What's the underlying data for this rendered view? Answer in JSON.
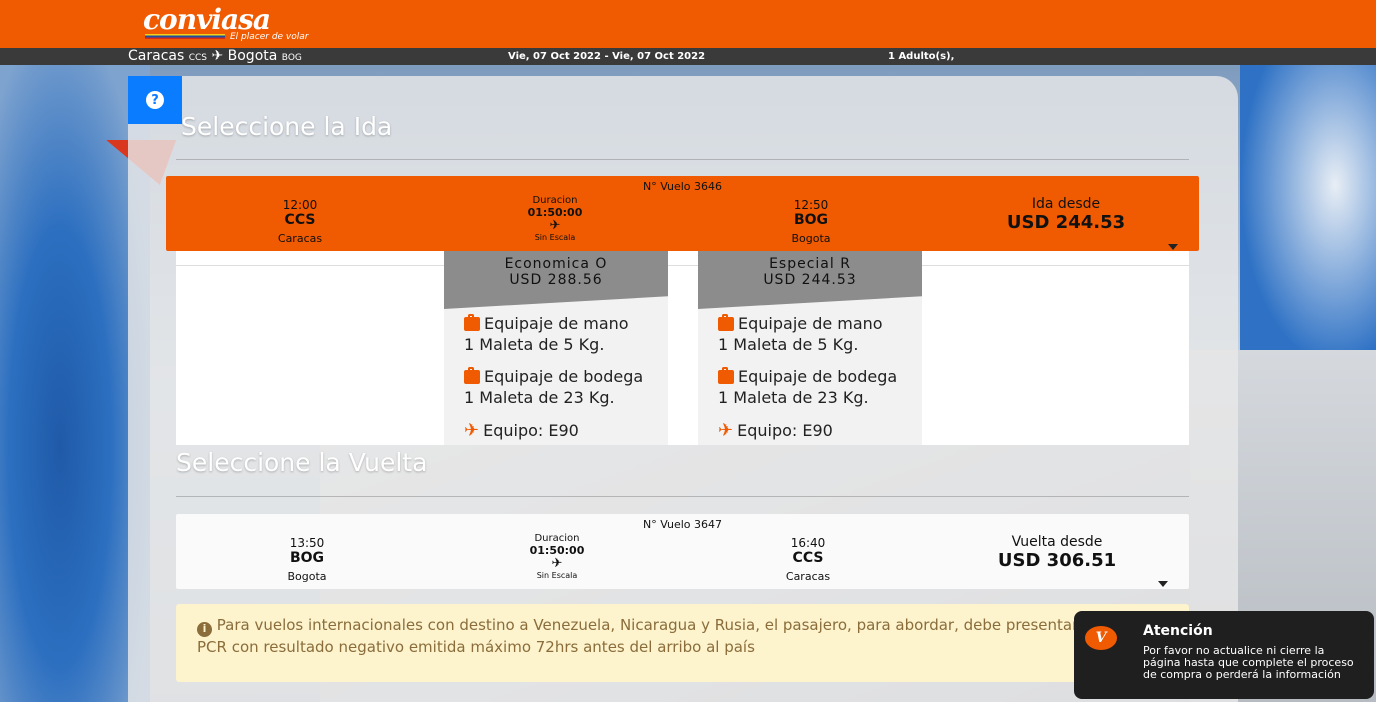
{
  "brand": {
    "logo_text": "conviasa",
    "tagline": "El placer de volar",
    "accent": "#f05a00"
  },
  "search": {
    "origin_city": "Caracas",
    "origin_code": "CCS",
    "destination_city": "Bogota",
    "destination_code": "BOG",
    "dates": "Vie, 07 Oct 2022 - Vie, 07 Oct 2022",
    "passengers": "1 Adulto(s),"
  },
  "outbound": {
    "title": "Seleccione la Ida",
    "flight_number": "N° Vuelo 3646",
    "depart_time": "12:00",
    "depart_code": "CCS",
    "depart_city": "Caracas",
    "duration_label": "Duracion",
    "duration": "01:50:00",
    "stops": "Sin Escala",
    "arrive_time": "12:50",
    "arrive_code": "BOG",
    "arrive_city": "Bogota",
    "price_label": "Ida desde",
    "price": "USD 244.53"
  },
  "fares": [
    {
      "name": "Economica O",
      "price": "USD 288.56",
      "carry_on_label": "Equipaje de mano",
      "carry_on_value": "1 Maleta de 5 Kg.",
      "checked_label": "Equipaje de bodega",
      "checked_value": "1 Maleta de 23 Kg.",
      "equipment": "Equipo: E90"
    },
    {
      "name": "Especial R",
      "price": "USD 244.53",
      "carry_on_label": "Equipaje de mano",
      "carry_on_value": "1 Maleta de 5 Kg.",
      "checked_label": "Equipaje de bodega",
      "checked_value": "1 Maleta de 23 Kg.",
      "equipment": "Equipo: E90"
    }
  ],
  "return": {
    "title": "Seleccione la Vuelta",
    "flight_number": "N° Vuelo 3647",
    "depart_time": "13:50",
    "depart_code": "BOG",
    "depart_city": "Bogota",
    "duration_label": "Duracion",
    "duration": "01:50:00",
    "stops": "Sin Escala",
    "arrive_time": "16:40",
    "arrive_code": "CCS",
    "arrive_city": "Caracas",
    "price_label": "Vuelta desde",
    "price": "USD 306.51"
  },
  "notice": {
    "text": "Para vuelos internacionales con destino a Venezuela, Nicaragua y Rusia, el pasajero, para abordar, debe presentar la prueba PCR con resultado negativo emitida máximo 72hrs antes del arribo al país"
  },
  "toast": {
    "title": "Atención",
    "message": "Por favor no actualice ni cierre la página hasta que complete el proceso de compra o perderá la información"
  }
}
